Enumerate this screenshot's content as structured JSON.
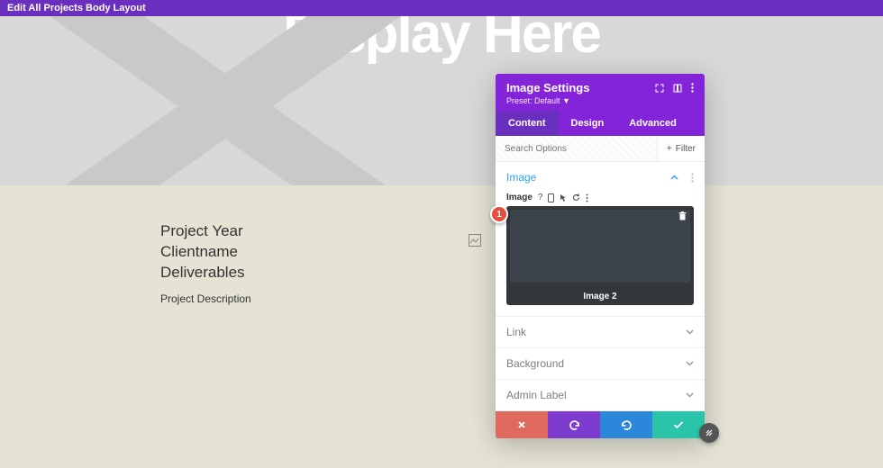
{
  "topbar": {
    "title": "Edit All Projects Body Layout"
  },
  "hero": {
    "text": "Display Here"
  },
  "project": {
    "line1": "Project Year",
    "line2": "Clientname",
    "line3": "Deliverables",
    "desc": "Project Description"
  },
  "panel": {
    "title": "Image Settings",
    "preset": "Preset: Default",
    "tabs": {
      "content": "Content",
      "design": "Design",
      "advanced": "Advanced"
    },
    "search_placeholder": "Search Options",
    "filter_label": "Filter",
    "sections": {
      "image": {
        "title": "Image",
        "field_label": "Image",
        "caption": "Image 2"
      },
      "link": "Link",
      "background": "Background",
      "admin_label": "Admin Label"
    }
  },
  "marker": "1"
}
